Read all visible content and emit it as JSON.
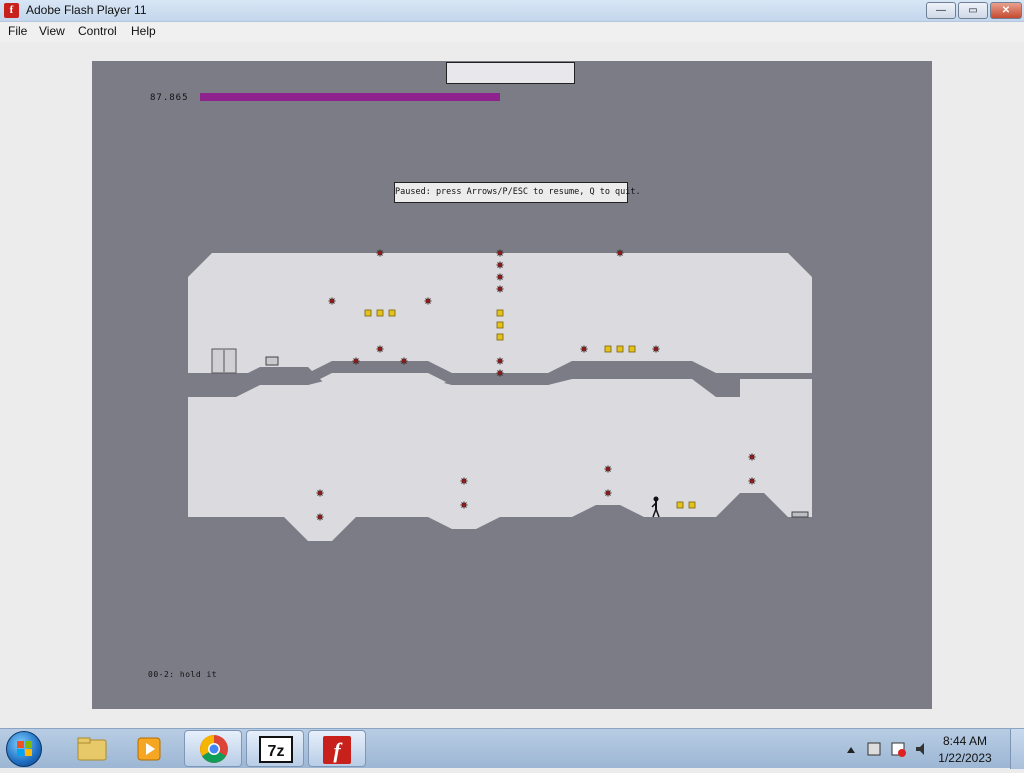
{
  "window": {
    "title": "Adobe Flash Player 11",
    "buttons": {
      "minimize": "—",
      "maximize": "▭",
      "close": "✕"
    }
  },
  "menu": {
    "items": [
      "File",
      "View",
      "Control",
      "Help"
    ]
  },
  "game": {
    "time_value": "87.865",
    "time_bar_fraction": 1.0,
    "pause_message": "Paused: press Arrows/P/ESC to resume, Q to quit.",
    "level_label": "00-2: hold it",
    "colors": {
      "background": "#7c7c87",
      "floor": "#dadadf",
      "time_bar": "#8e238e",
      "gold": "#e3c31b",
      "mine": "#8b1a1a"
    }
  },
  "taskbar": {
    "apps": [
      "start-orb",
      "windows-explorer-icon",
      "media-player-icon",
      "chrome-icon",
      "7zip-icon",
      "flash-player-icon"
    ],
    "active_app": "flash-player-icon",
    "clock": {
      "time": "8:44 AM",
      "date": "1/22/2023"
    }
  }
}
